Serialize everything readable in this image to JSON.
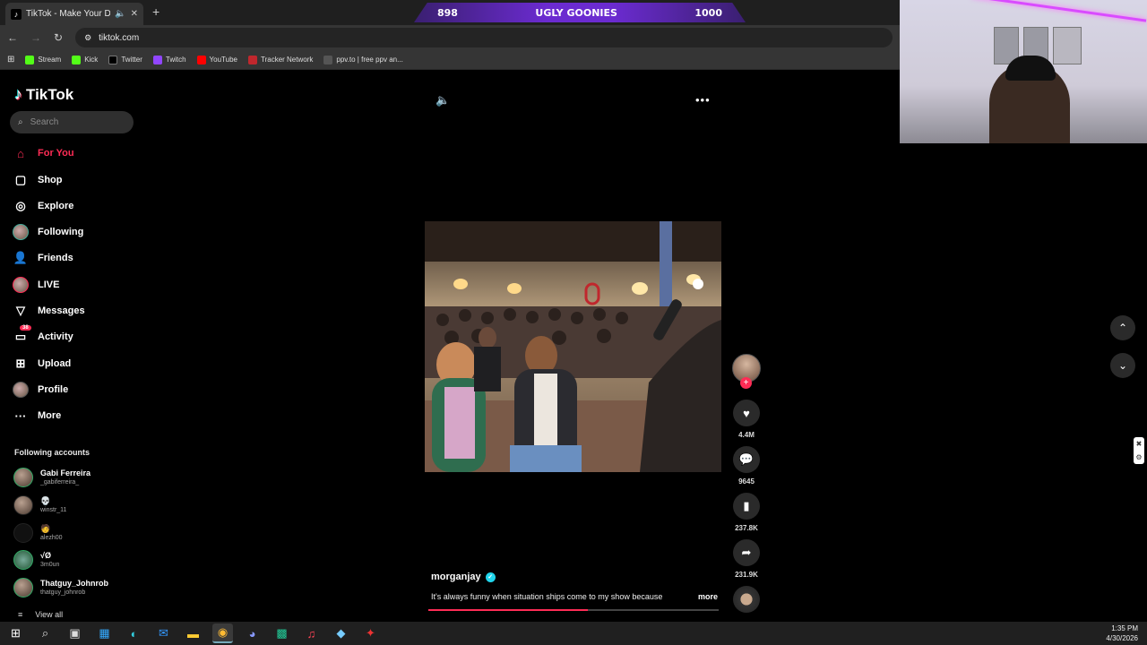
{
  "browser": {
    "tab_title": "TikTok - Make Your Day",
    "new_tab": "+",
    "url": "tiktok.com",
    "bookmarks": [
      "Stream",
      "Kick",
      "Twitter",
      "Twitch",
      "YouTube",
      "Tracker Network",
      "ppv.to | free ppv an..."
    ]
  },
  "stream_overlay": {
    "left": "898",
    "title": "UGLY GOONIES",
    "right": "1000"
  },
  "sidebar": {
    "logo": "TikTok",
    "search_placeholder": "Search",
    "nav": [
      {
        "label": "For You",
        "icon": "home-icon"
      },
      {
        "label": "Shop",
        "icon": "shop-bag-icon"
      },
      {
        "label": "Explore",
        "icon": "compass-icon"
      },
      {
        "label": "Following",
        "icon": "avatar-icon"
      },
      {
        "label": "Friends",
        "icon": "friends-icon"
      },
      {
        "label": "LIVE",
        "icon": "live-avatar-icon"
      },
      {
        "label": "Messages",
        "icon": "paper-plane-icon"
      },
      {
        "label": "Activity",
        "icon": "activity-icon",
        "badge": "38"
      },
      {
        "label": "Upload",
        "icon": "plus-square-icon"
      },
      {
        "label": "Profile",
        "icon": "profile-avatar-icon"
      },
      {
        "label": "More",
        "icon": "more-dots-icon"
      }
    ],
    "following_title": "Following accounts",
    "accounts": [
      {
        "name": "Gabi Ferreira",
        "handle": "_gabiferreira_"
      },
      {
        "name": "💀",
        "handle": "winstr_11"
      },
      {
        "name": "🧑",
        "handle": "alezh00"
      },
      {
        "name": "√Ø",
        "handle": "3m0un"
      },
      {
        "name": "Thatguy_Johnrob",
        "handle": "thatguy_johnrob"
      }
    ],
    "view_all": "View all"
  },
  "video": {
    "author": "morganjay",
    "caption": "It's always funny when situation ships come to my show because",
    "more": "more",
    "progress": 0.55
  },
  "rail": {
    "likes": "4.4M",
    "comments": "9645",
    "saves": "237.8K",
    "shares": "231.9K"
  },
  "clock": {
    "time": "1:35 PM",
    "date": "4/30/2026"
  }
}
